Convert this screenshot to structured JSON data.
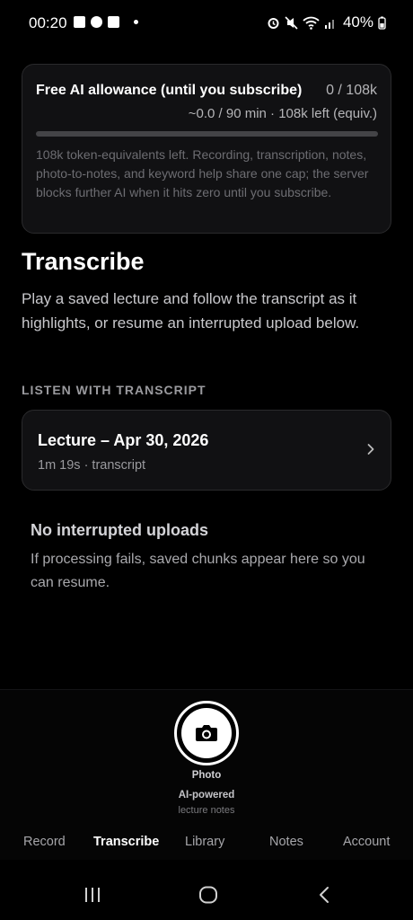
{
  "status_bar": {
    "time": "00:20",
    "battery": "40%"
  },
  "allowance": {
    "title": "Free AI allowance (until you subscribe)",
    "count": "0 / 108k",
    "subtitle": "~0.0 / 90 min · 108k left (equiv.)",
    "usage_fraction": 0,
    "description": "108k token-equivalents left. Recording, transcription, notes, photo-to-notes, and keyword help share one cap; the server blocks further AI when it hits zero until you subscribe."
  },
  "page": {
    "title": "Transcribe",
    "description": "Play a saved lecture and follow the transcript as it highlights, or resume an interrupted upload below."
  },
  "listen_section": {
    "header": "LISTEN WITH TRANSCRIPT",
    "lectures": [
      {
        "title": "Lecture – Apr 30, 2026",
        "meta": "1m 19s · transcript"
      }
    ]
  },
  "uploads": {
    "empty_title": "No interrupted uploads",
    "empty_description": "If processing fails, saved chunks appear here so you can resume."
  },
  "photo_action": {
    "label": "Photo",
    "tagline": "AI-powered",
    "sub": "lecture notes",
    "icon": "camera-icon"
  },
  "tabs": [
    {
      "label": "Record",
      "active": false
    },
    {
      "label": "Transcribe",
      "active": true
    },
    {
      "label": "Library",
      "active": false
    },
    {
      "label": "Notes",
      "active": false
    },
    {
      "label": "Account",
      "active": false
    }
  ],
  "colors": {
    "background": "#000000",
    "card": "#111113",
    "card_border": "#2a2a2c",
    "text_primary": "#ffffff",
    "text_muted": "#9a9a9e"
  }
}
